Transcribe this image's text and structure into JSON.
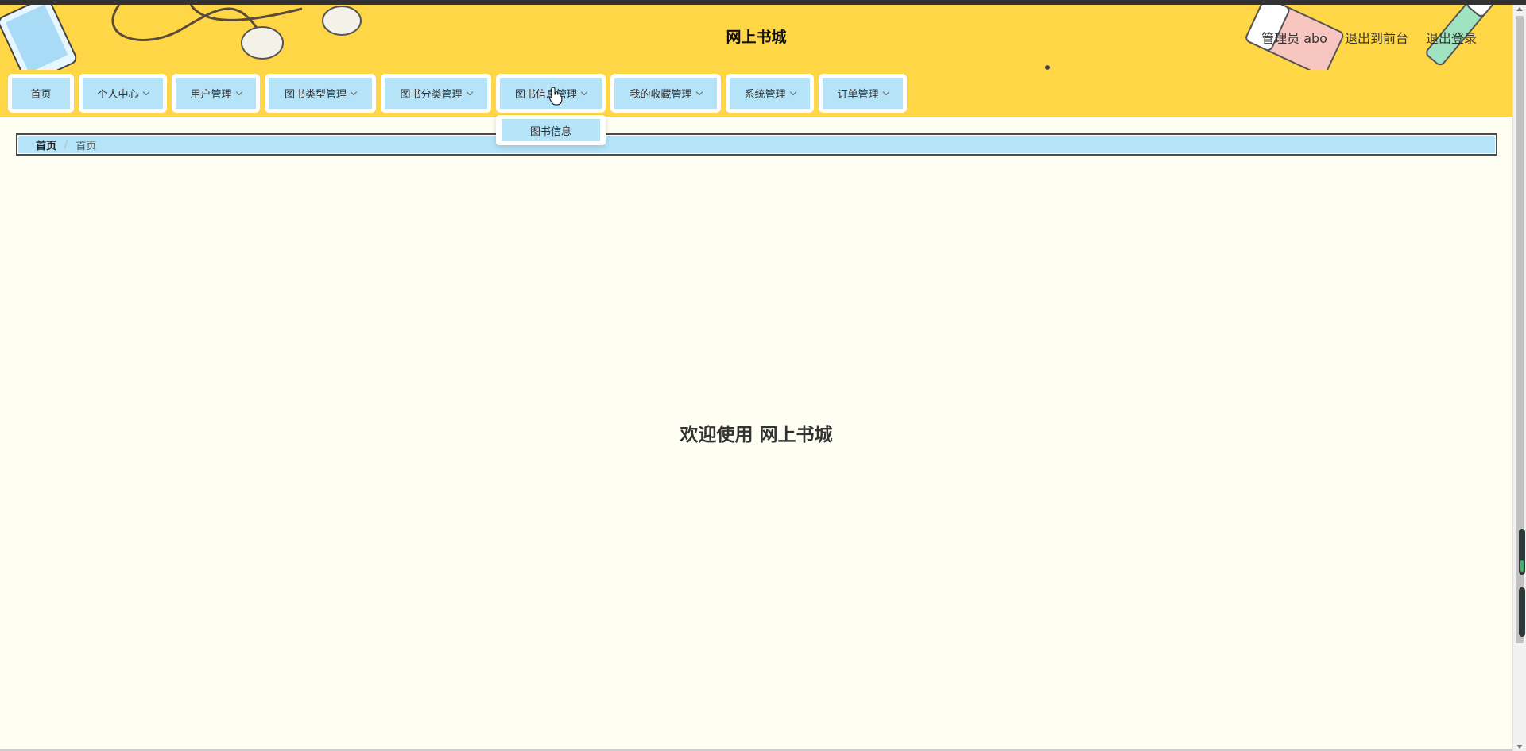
{
  "header": {
    "title": "网上书城",
    "user_label": "管理员 abo",
    "back_to_front": "退出到前台",
    "logout": "退出登录"
  },
  "nav": {
    "items": [
      {
        "label": "首页"
      },
      {
        "label": "个人中心"
      },
      {
        "label": "用户管理"
      },
      {
        "label": "图书类型管理"
      },
      {
        "label": "图书分类管理"
      },
      {
        "label": "图书信息管理"
      },
      {
        "label": "我的收藏管理"
      },
      {
        "label": "系统管理"
      },
      {
        "label": "订单管理"
      }
    ],
    "open_submenu": {
      "items": [
        {
          "label": "图书信息"
        }
      ]
    }
  },
  "breadcrumb": {
    "home": "首页",
    "separator": "/",
    "current": "首页"
  },
  "main": {
    "welcome": "欢迎使用 网上书城"
  },
  "colors": {
    "header_bg": "#ffd645",
    "nav_item_bg": "#b5e3f8",
    "page_bg": "#fffef2"
  }
}
